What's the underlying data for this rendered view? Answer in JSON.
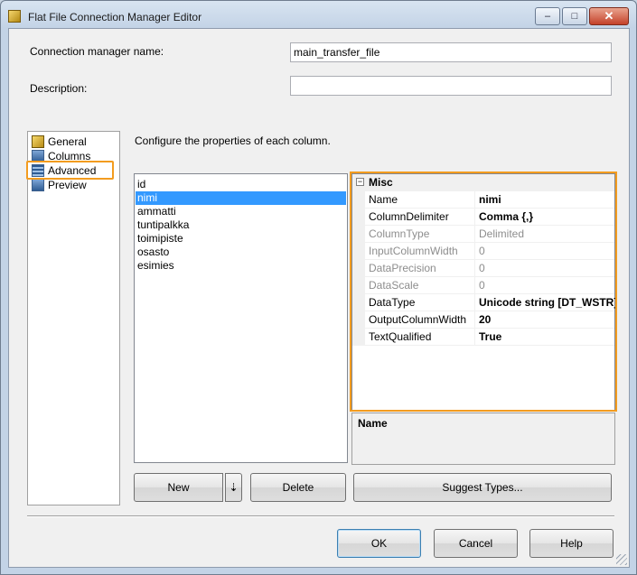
{
  "window": {
    "title": "Flat File Connection Manager Editor",
    "minimize_glyph": "–",
    "maximize_glyph": "□",
    "close_glyph": "✕"
  },
  "form": {
    "name_label": "Connection manager name:",
    "name_value": "main_transfer_file",
    "description_label": "Description:",
    "description_value": ""
  },
  "nav": {
    "items": [
      {
        "label": "General",
        "icon": "general-icon"
      },
      {
        "label": "Columns",
        "icon": "columns-icon"
      },
      {
        "label": "Advanced",
        "icon": "advanced-icon"
      },
      {
        "label": "Preview",
        "icon": "preview-icon"
      }
    ],
    "selected": "Advanced"
  },
  "instructions": "Configure the properties of each column.",
  "columns": {
    "items": [
      "id",
      "nimi",
      "ammatti",
      "tuntipalkka",
      "toimipiste",
      "osasto",
      "esimies"
    ],
    "selected": "nimi"
  },
  "properties": {
    "category": "Misc",
    "toggle_glyph": "−",
    "rows": [
      {
        "name": "Name",
        "value": "nimi",
        "enabled": true,
        "bold": true
      },
      {
        "name": "ColumnDelimiter",
        "value": "Comma {,}",
        "enabled": true,
        "bold": true
      },
      {
        "name": "ColumnType",
        "value": "Delimited",
        "enabled": false,
        "bold": false
      },
      {
        "name": "InputColumnWidth",
        "value": "0",
        "enabled": false,
        "bold": false
      },
      {
        "name": "DataPrecision",
        "value": "0",
        "enabled": false,
        "bold": false
      },
      {
        "name": "DataScale",
        "value": "0",
        "enabled": false,
        "bold": false
      },
      {
        "name": "DataType",
        "value": "Unicode string [DT_WSTR]",
        "enabled": true,
        "bold": true
      },
      {
        "name": "OutputColumnWidth",
        "value": "20",
        "enabled": true,
        "bold": true
      },
      {
        "name": "TextQualified",
        "value": "True",
        "enabled": true,
        "bold": true
      }
    ]
  },
  "description_panel": {
    "title": "Name"
  },
  "buttons": {
    "new": "New",
    "new_dropdown_glyph": "⇣",
    "delete": "Delete",
    "suggest": "Suggest Types...",
    "ok": "OK",
    "cancel": "Cancel",
    "help": "Help"
  },
  "colors": {
    "highlight": "#f39c1f",
    "selection": "#3399ff"
  }
}
